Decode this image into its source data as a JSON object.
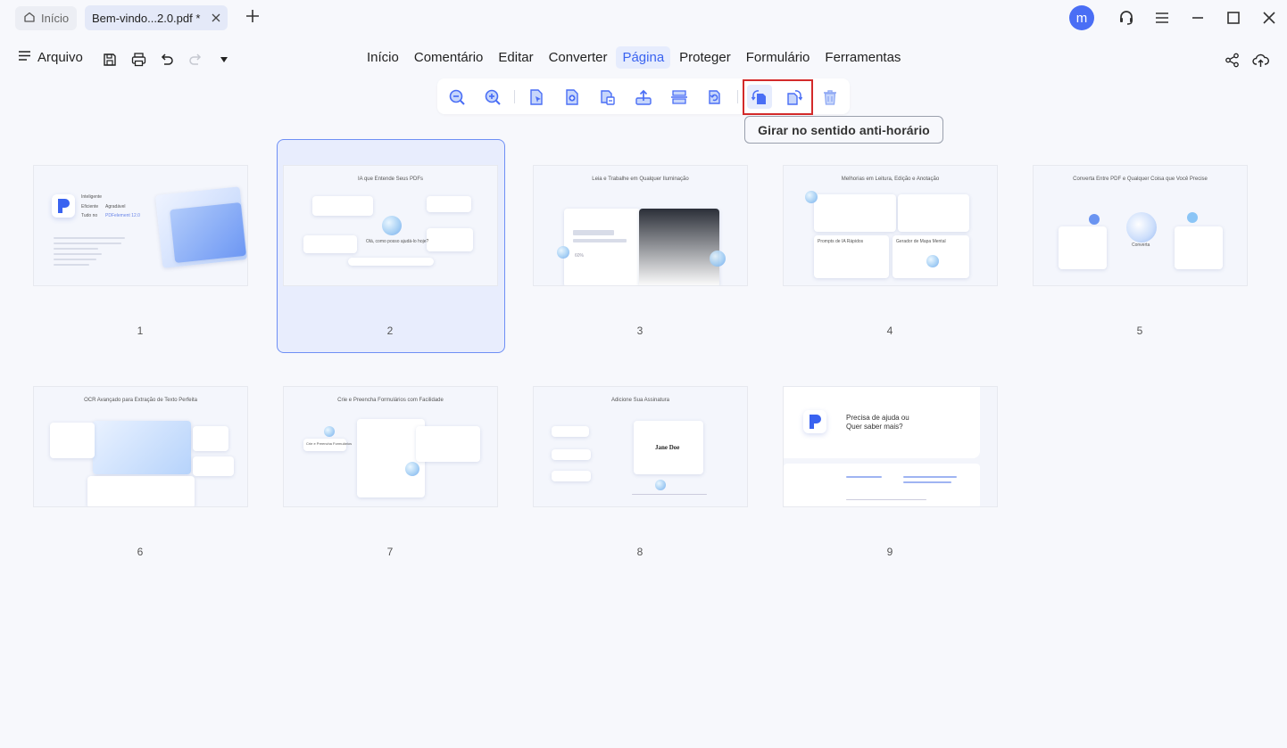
{
  "tabs": {
    "home_label": "Início",
    "document_label": "Bem-vindo...2.0.pdf *"
  },
  "user": {
    "avatar_letter": "m"
  },
  "file_menu": {
    "label": "Arquivo"
  },
  "menu": {
    "items": [
      "Início",
      "Comentário",
      "Editar",
      "Converter",
      "Página",
      "Proteger",
      "Formulário",
      "Ferramentas"
    ],
    "active": "Página"
  },
  "page_toolbar": {
    "buttons": [
      "zoom-out",
      "zoom-in",
      "extract-page",
      "insert-page",
      "replace-page",
      "export-page",
      "split-page",
      "reverse-page",
      "rotate-counterclockwise",
      "rotate-clockwise",
      "delete-page"
    ],
    "highlighted": [
      "rotate-counterclockwise",
      "rotate-clockwise"
    ],
    "tooltip": "Girar no sentido anti-horário"
  },
  "thumbnails": {
    "selected_page": 2,
    "pages": [
      {
        "number": "1",
        "title": "",
        "texts": [
          "Inteligente",
          "Eficiente",
          "Agradável",
          "Tudo no",
          "PDFelement 12.0"
        ]
      },
      {
        "number": "2",
        "title": "IA que Entende Seus PDFs",
        "texts": [
          "Olá, como posso ajudá-lo hoje?"
        ]
      },
      {
        "number": "3",
        "title": "Leia e Trabalhe em Qualquer Iluminação",
        "texts": [
          "60%"
        ]
      },
      {
        "number": "4",
        "title": "Melhorias em Leitura, Edição e Anotação",
        "texts": [
          "Prompts de IA Rápidos",
          "Gerador de Mapa Mental"
        ]
      },
      {
        "number": "5",
        "title": "Converta Entre PDF e Qualquer Coisa que Você Precise",
        "texts": [
          "Converta"
        ]
      },
      {
        "number": "6",
        "title": "OCR Avançado para Extração de Texto Perfeita",
        "texts": []
      },
      {
        "number": "7",
        "title": "Crie e Preencha Formulários com Facilidade",
        "texts": [
          "Crie e Preencha Formulários"
        ]
      },
      {
        "number": "8",
        "title": "Adicione Sua Assinatura",
        "texts": [
          "Jane Doe"
        ]
      },
      {
        "number": "9",
        "title": "",
        "texts": [
          "Precisa de ajuda ou",
          "Quer saber mais?"
        ]
      }
    ]
  },
  "colors": {
    "accent": "#3a63f0",
    "active_bg": "#e6ecfd",
    "highlight_border": "#d32a2a",
    "avatar": "#4a6ef5"
  }
}
